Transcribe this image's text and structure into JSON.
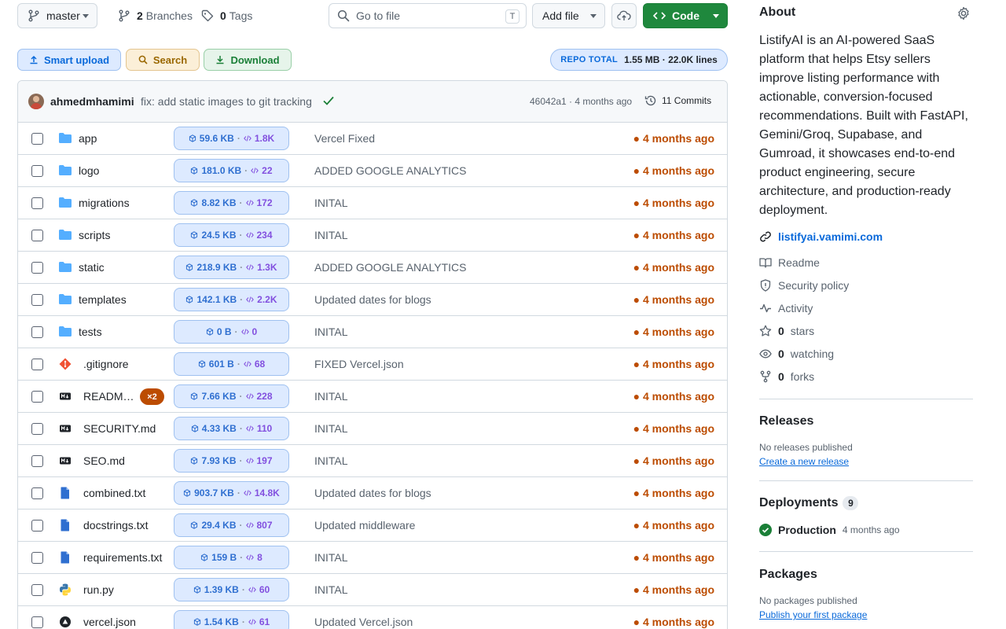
{
  "toolbar": {
    "branch": "master",
    "branches_count": "2",
    "branches_label": "Branches",
    "tags_count": "0",
    "tags_label": "Tags",
    "goto_placeholder": "Go to file",
    "goto_shortcut": "T",
    "add_file": "Add file",
    "code": "Code"
  },
  "actions": {
    "smart_upload": "Smart upload",
    "search": "Search",
    "download": "Download",
    "repo_total_label": "REPO TOTAL",
    "repo_total_value": "1.55 MB · 22.0K lines"
  },
  "commit": {
    "author": "ahmedmhamimi",
    "message": "fix: add static images to git tracking",
    "hash_time": "46042a1 · 4 months ago",
    "commits": "11 Commits"
  },
  "files": [
    {
      "name": "app",
      "type": "dir",
      "size": "59.6 KB",
      "lines": "1.8K",
      "message": "Vercel Fixed",
      "age": "4 months ago"
    },
    {
      "name": "logo",
      "type": "dir",
      "size": "181.0 KB",
      "lines": "22",
      "message": "ADDED GOOGLE ANALYTICS",
      "age": "4 months ago"
    },
    {
      "name": "migrations",
      "type": "dir",
      "size": "8.82 KB",
      "lines": "172",
      "message": "INITAL",
      "age": "4 months ago"
    },
    {
      "name": "scripts",
      "type": "dir",
      "size": "24.5 KB",
      "lines": "234",
      "message": "INITAL",
      "age": "4 months ago"
    },
    {
      "name": "static",
      "type": "dir",
      "size": "218.9 KB",
      "lines": "1.3K",
      "message": "ADDED GOOGLE ANALYTICS",
      "age": "4 months ago"
    },
    {
      "name": "templates",
      "type": "dir",
      "size": "142.1 KB",
      "lines": "2.2K",
      "message": "Updated dates for blogs",
      "age": "4 months ago"
    },
    {
      "name": "tests",
      "type": "dir",
      "size": "0 B",
      "lines": "0",
      "message": "INITAL",
      "age": "4 months ago"
    },
    {
      "name": ".gitignore",
      "type": "git",
      "size": "601 B",
      "lines": "68",
      "message": "FIXED Vercel.json",
      "age": "4 months ago"
    },
    {
      "name": "READM…",
      "type": "md",
      "badge": "×2",
      "size": "7.66 KB",
      "lines": "228",
      "message": "INITAL",
      "age": "4 months ago"
    },
    {
      "name": "SECURITY.md",
      "type": "md",
      "size": "4.33 KB",
      "lines": "110",
      "message": "INITAL",
      "age": "4 months ago"
    },
    {
      "name": "SEO.md",
      "type": "md",
      "size": "7.93 KB",
      "lines": "197",
      "message": "INITAL",
      "age": "4 months ago"
    },
    {
      "name": "combined.txt",
      "type": "txt",
      "size": "903.7 KB",
      "lines": "14.8K",
      "message": "Updated dates for blogs",
      "age": "4 months ago"
    },
    {
      "name": "docstrings.txt",
      "type": "txt",
      "size": "29.4 KB",
      "lines": "807",
      "message": "Updated middleware",
      "age": "4 months ago"
    },
    {
      "name": "requirements.txt",
      "type": "txt",
      "size": "159 B",
      "lines": "8",
      "message": "INITAL",
      "age": "4 months ago"
    },
    {
      "name": "run.py",
      "type": "py",
      "size": "1.39 KB",
      "lines": "60",
      "message": "INITAL",
      "age": "4 months ago"
    },
    {
      "name": "vercel.json",
      "type": "json",
      "size": "1.54 KB",
      "lines": "61",
      "message": "Updated Vercel.json",
      "age": "4 months ago"
    }
  ],
  "about": {
    "title": "About",
    "description": "ListifyAI is an AI-powered SaaS platform that helps Etsy sellers improve listing performance with actionable, conversion-focused recommendations. Built with FastAPI, Gemini/Groq, Supabase, and Gumroad, it showcases end-to-end product engineering, secure architecture, and production-ready deployment.",
    "website": "listifyai.vamimi.com",
    "readme": "Readme",
    "security": "Security policy",
    "activity": "Activity",
    "stars_count": "0",
    "stars_label": "stars",
    "watching_count": "0",
    "watching_label": "watching",
    "forks_count": "0",
    "forks_label": "forks"
  },
  "releases": {
    "title": "Releases",
    "empty": "No releases published",
    "create": "Create a new release"
  },
  "deployments": {
    "title": "Deployments",
    "count": "9",
    "env": "Production",
    "when": "4 months ago"
  },
  "packages": {
    "title": "Packages",
    "empty": "No packages published",
    "publish": "Publish your first package"
  },
  "colors": {
    "age": "#bc4c00",
    "code_button": "#1f883d",
    "link": "#0969da",
    "folder": "#54aeff"
  }
}
